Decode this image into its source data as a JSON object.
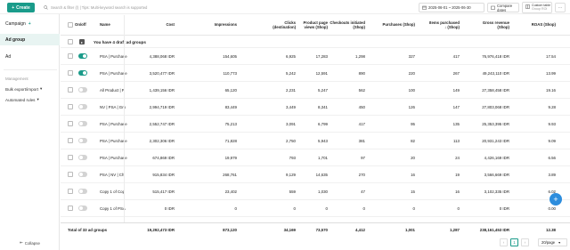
{
  "toolbar": {
    "create_label": "Create",
    "search_placeholder": "Search & filter (/) | Tips: Multi-keyword search is supported",
    "date_range": "2025-06-01 ~ 2025-06-30",
    "compare_label": "Compare dates",
    "custom_table_line1": "Custom table",
    "custom_table_line2": "Group ROI",
    "more_label": "⋯"
  },
  "sidebar": {
    "items": [
      {
        "label": "Campaign"
      },
      {
        "label": "Ad group"
      },
      {
        "label": "Ad"
      }
    ],
    "group_label": "Management",
    "links": [
      {
        "label": "Bulk export/import"
      },
      {
        "label": "Automated rules"
      }
    ],
    "collapse_label": "Collapse"
  },
  "table": {
    "headers": {
      "onoff": "On/off",
      "name": "Name",
      "cost": "Cost",
      "impressions": "Impressions",
      "clicks": "Clicks (destination)",
      "ppv": "Product page views (Shop)",
      "checkouts": "Checkouts initiated (Shop)",
      "purchases": "Purchases (Shop)",
      "items": "Items purchased ↓ (Shop)",
      "revenue": "Gross revenue (Shop)",
      "roas": "ROAS (Shop)"
    },
    "draft_text": "You have 4 draft ad groups",
    "rows": [
      {
        "on": true,
        "name": "PSA | Purchase",
        "cost": "4,388,068 IDR",
        "impressions": "154,605",
        "clicks": "6,925",
        "ppv": "17,283",
        "checkouts": "1,298",
        "purchases": "327",
        "items": "417",
        "revenue": "76,976,418 IDR",
        "roas": "17.54"
      },
      {
        "on": true,
        "name": "PSA | Purchase",
        "cost": "3,520,477 IDR",
        "impressions": "110,773",
        "clicks": "5,242",
        "ppv": "12,591",
        "checkouts": "890",
        "purchases": "220",
        "items": "267",
        "revenue": "49,243,110 IDR",
        "roas": "13.99"
      },
      {
        "on": false,
        "name": "All Product | P",
        "cost": "1,439,156 IDR",
        "impressions": "65,120",
        "clicks": "2,231",
        "ppv": "5,247",
        "checkouts": "562",
        "purchases": "100",
        "items": "149",
        "revenue": "27,358,458 IDR",
        "roas": "19.16"
      },
      {
        "on": false,
        "name": "NV | PSA | Gro",
        "cost": "2,994,719 IDR",
        "impressions": "83,449",
        "clicks": "3,449",
        "ppv": "8,341",
        "checkouts": "450",
        "purchases": "126",
        "items": "147",
        "revenue": "27,803,068 IDR",
        "roas": "9.28"
      },
      {
        "on": false,
        "name": "PSA | Purchase",
        "cost": "2,552,747 IDR",
        "impressions": "75,213",
        "clicks": "3,091",
        "ppv": "6,799",
        "checkouts": "417",
        "purchases": "95",
        "items": "135",
        "revenue": "25,353,395 IDR",
        "roas": "9.93"
      },
      {
        "on": false,
        "name": "PSA | Purchase",
        "cost": "2,302,306 IDR",
        "impressions": "71,828",
        "clicks": "2,750",
        "ppv": "5,943",
        "checkouts": "381",
        "purchases": "82",
        "items": "113",
        "revenue": "20,931,243 IDR",
        "roas": "9.09"
      },
      {
        "on": false,
        "name": "PSA | Purchase",
        "cost": "674,869 IDR",
        "impressions": "19,979",
        "clicks": "793",
        "ppv": "1,701",
        "checkouts": "97",
        "purchases": "20",
        "items": "24",
        "revenue": "4,426,169 IDR",
        "roas": "6.56"
      },
      {
        "on": false,
        "name": "PSA | NV | Ch",
        "cost": "915,834 IDR",
        "impressions": "268,761",
        "clicks": "9,129",
        "ppv": "14,635",
        "checkouts": "270",
        "purchases": "16",
        "items": "19",
        "revenue": "3,566,669 IDR",
        "roas": "3.89"
      },
      {
        "on": false,
        "name": "Copy 1 of Cop",
        "cost": "515,417 IDR",
        "impressions": "23,402",
        "clicks": "559",
        "ppv": "1,030",
        "checkouts": "47",
        "purchases": "15",
        "items": "16",
        "revenue": "3,102,335 IDR",
        "roas": "6.02"
      },
      {
        "on": false,
        "name": "Copy 1 of PSA",
        "cost": "0 IDR",
        "impressions": "0",
        "clicks": "0",
        "ppv": "0",
        "checkouts": "0",
        "purchases": "0",
        "items": "0",
        "revenue": "0 IDR",
        "roas": "0.00"
      },
      {
        "on": false,
        "name": "All Product | P",
        "cost": "0 IDR",
        "impressions": "0",
        "clicks": "0",
        "ppv": "0",
        "checkouts": "0",
        "purchases": "0",
        "items": "0",
        "revenue": "0 IDR",
        "roas": "0.00"
      }
    ],
    "total": {
      "label": "Total of 33 ad groups",
      "cost": "19,292,473 IDR",
      "impressions": "873,120",
      "clicks": "34,169",
      "ppv": "73,570",
      "checkouts": "4,412",
      "purchases": "1,001",
      "items": "1,287",
      "revenue": "238,161,453 IDR",
      "roas": "12.38"
    }
  },
  "pager": {
    "prev": "‹",
    "current": "1",
    "next": "›",
    "page_size": "20/page"
  }
}
